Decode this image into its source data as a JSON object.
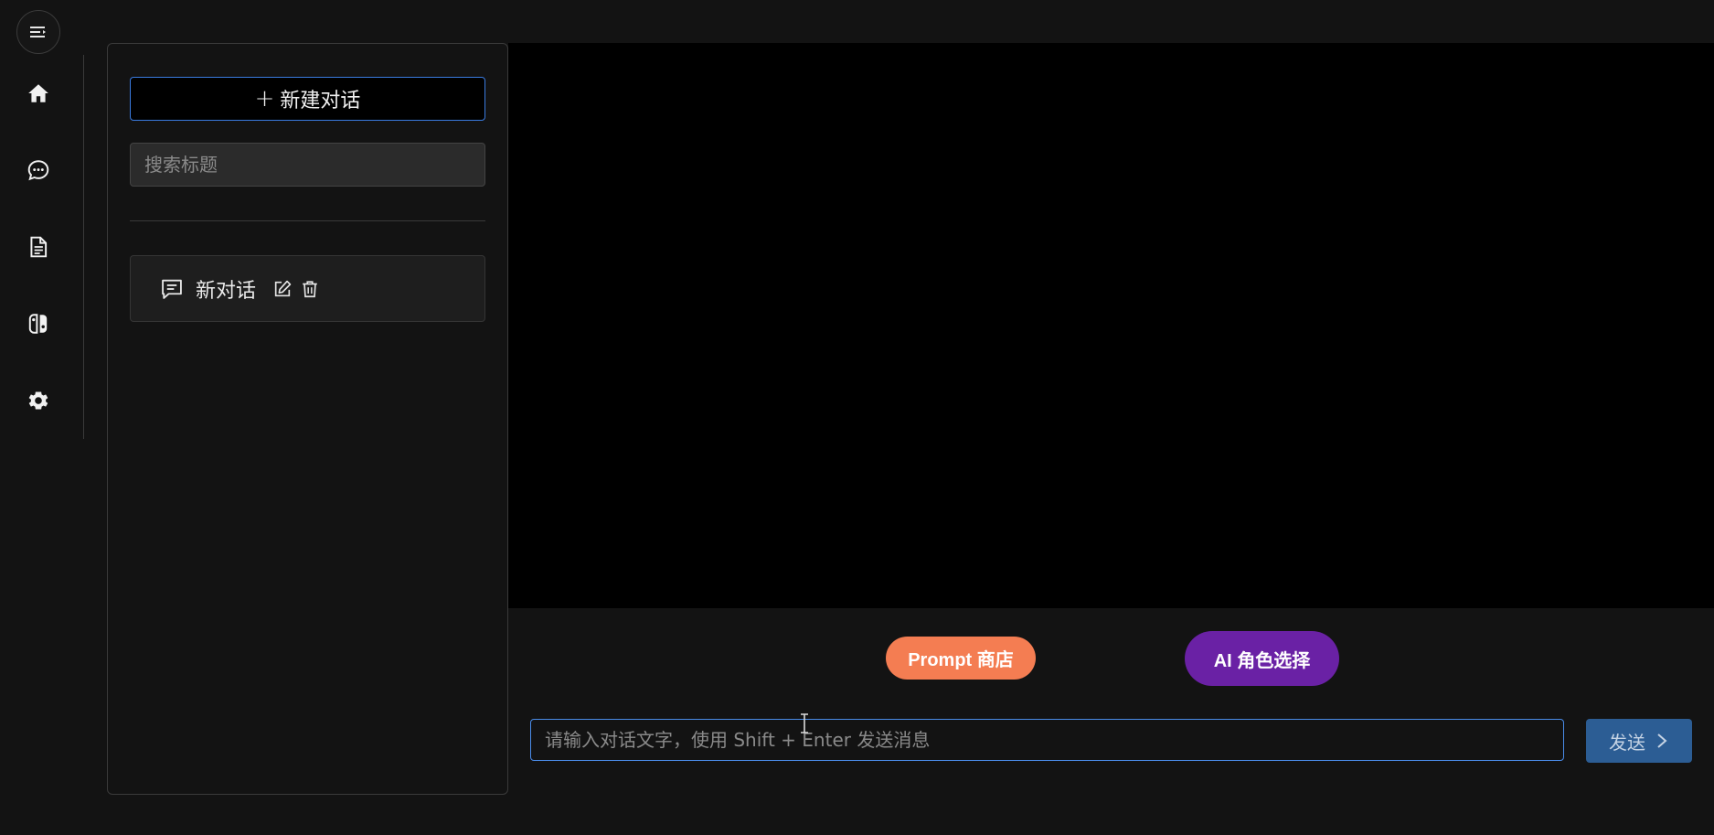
{
  "rail": {
    "items": [
      {
        "name": "home",
        "icon": "home-icon"
      },
      {
        "name": "chat",
        "icon": "chat-bubble-icon"
      },
      {
        "name": "document",
        "icon": "document-icon"
      },
      {
        "name": "game",
        "icon": "game-controller-icon"
      },
      {
        "name": "settings",
        "icon": "gear-icon"
      }
    ]
  },
  "panel": {
    "new_chat_label": "新建对话",
    "search_placeholder": "搜索标题",
    "conversations": [
      {
        "title": "新对话"
      }
    ]
  },
  "actions": {
    "prompt_store": "Prompt 商店",
    "ai_role": "AI 角色选择"
  },
  "composer": {
    "placeholder": "请输入对话文字，使用 Shift + Enter 发送消息",
    "value": "",
    "send_label": "发送"
  },
  "colors": {
    "background": "#131313",
    "messages_bg": "#000000",
    "accent_blue": "#3a7be0",
    "prompt_orange": "#f47d52",
    "role_purple": "#6a21a5",
    "send_blue": "#2c5d94"
  }
}
